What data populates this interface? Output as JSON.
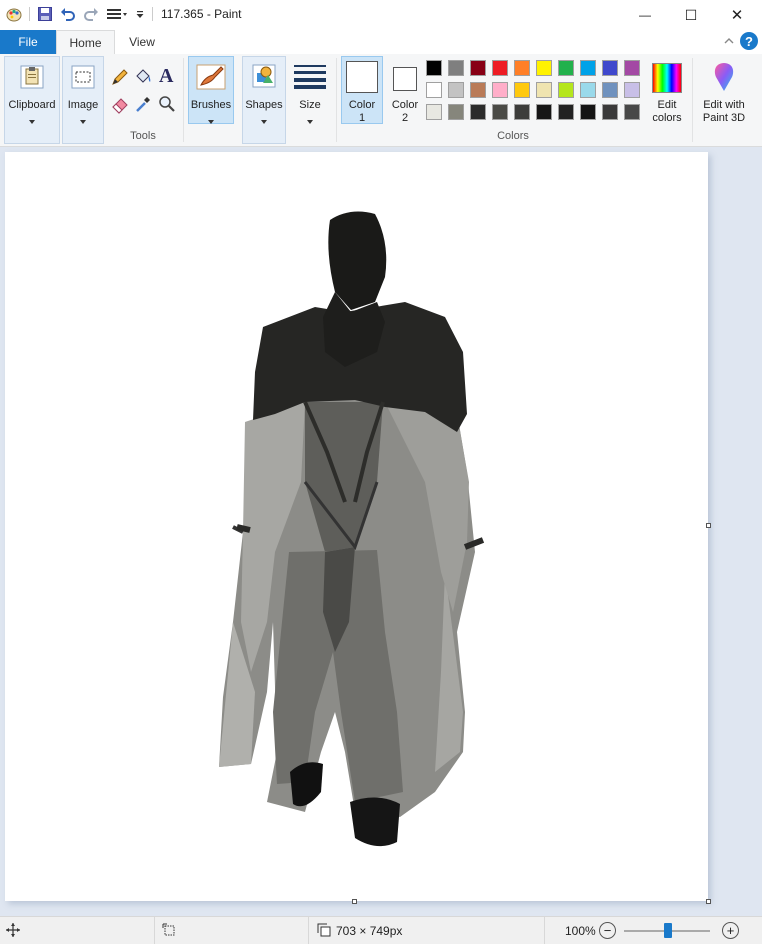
{
  "window": {
    "title": "117.365 - Paint",
    "minimize_glyph": "—",
    "maximize_glyph": "☐",
    "close_glyph": "✕"
  },
  "tabs": {
    "file": "File",
    "home": "Home",
    "view": "View"
  },
  "ribbon": {
    "clipboard": "Clipboard",
    "image": "Image",
    "tools_label": "Tools",
    "brushes": "Brushes",
    "shapes": "Shapes",
    "size": "Size",
    "color1_line1": "Color",
    "color1_line2": "1",
    "color2_line1": "Color",
    "color2_line2": "2",
    "colors_label": "Colors",
    "edit_colors_line1": "Edit",
    "edit_colors_line2": "colors",
    "paint3d_line1": "Edit with",
    "paint3d_line2": "Paint 3D",
    "text_tool_glyph": "A"
  },
  "palette": [
    [
      "#000000",
      "#7f7f7f",
      "#880015",
      "#ed1c24",
      "#ff7f27",
      "#fff200",
      "#22b14c",
      "#00a2e8",
      "#3f48cc",
      "#a349a4"
    ],
    [
      "#ffffff",
      "#c3c3c3",
      "#b97a57",
      "#ffaec9",
      "#ffc90e",
      "#efe4b0",
      "#b5e61d",
      "#99d9ea",
      "#7092be",
      "#c8bfe7"
    ],
    [
      "#e8e8e2",
      "#86867c",
      "#2b2b2b",
      "#4a4a46",
      "#3c3c3a",
      "#161616",
      "#222222",
      "#141414",
      "#3a3a3a",
      "#484848"
    ]
  ],
  "colors": {
    "accent": "#1979ca",
    "color1": "#ffffff",
    "color2": "#ffffff"
  },
  "status": {
    "canvas_size": "703 × 749px",
    "zoom": "100%",
    "zoom_minus": "−",
    "zoom_plus": "+"
  }
}
